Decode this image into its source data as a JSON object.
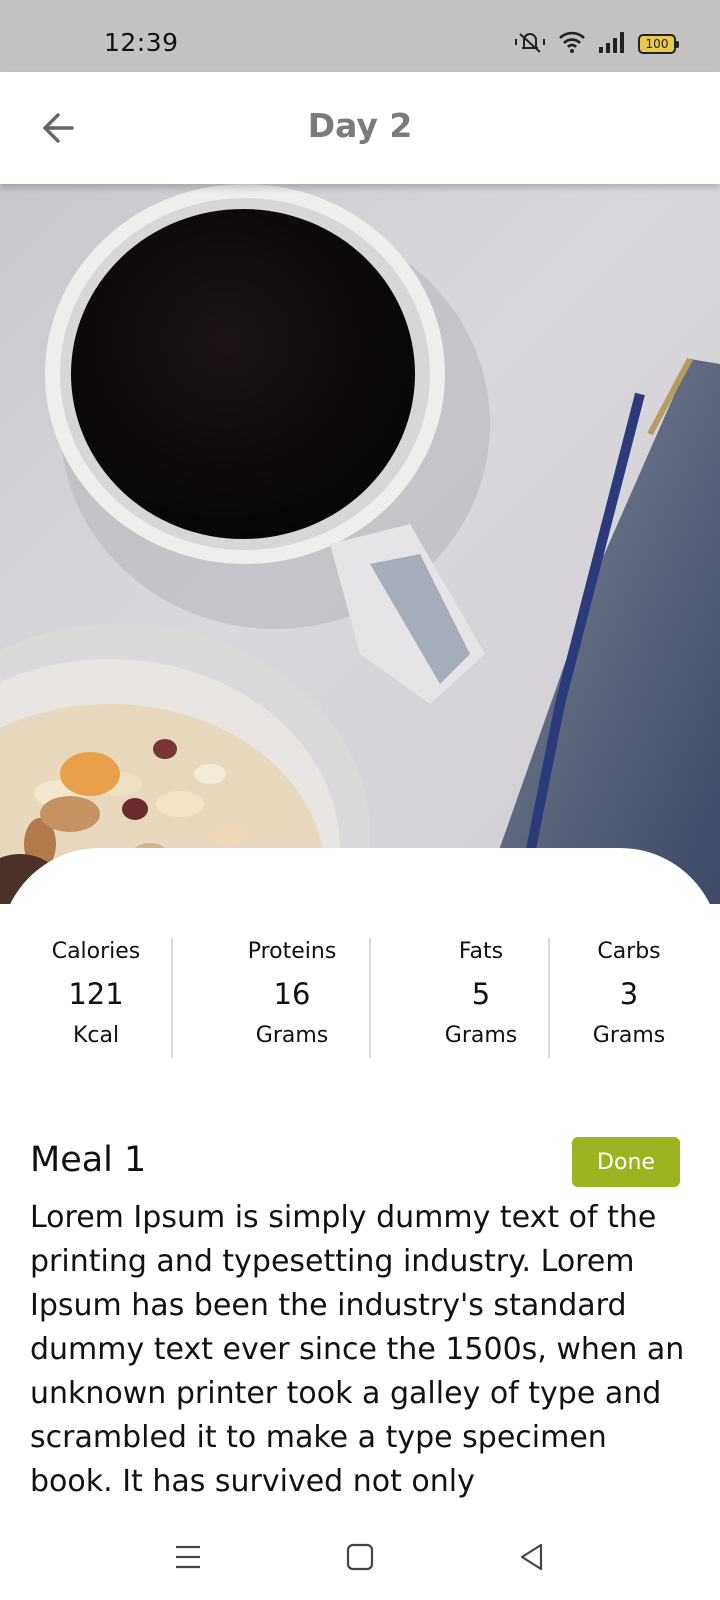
{
  "status_bar": {
    "time": "12:39",
    "battery": "100",
    "icons": [
      "vibrate-off-icon",
      "wifi-icon",
      "signal-icon",
      "battery-icon"
    ]
  },
  "app_bar": {
    "title": "Day 2",
    "back_icon": "arrow-left-icon"
  },
  "hero_image": {
    "subject": "coffee-mug-granola-bowl-book",
    "accent_colors": [
      "#0e0b0d",
      "#3b4a63",
      "#e7d7b9"
    ]
  },
  "stats": [
    {
      "label": "Calories",
      "value": "121",
      "unit": "Kcal"
    },
    {
      "label": "Proteins",
      "value": "16",
      "unit": "Grams"
    },
    {
      "label": "Fats",
      "value": "5",
      "unit": "Grams"
    },
    {
      "label": "Carbs",
      "value": "3",
      "unit": "Grams"
    }
  ],
  "meal": {
    "title": "Meal 1",
    "done_label": "Done",
    "description": "Lorem Ipsum is simply dummy text of the printing and typesetting industry. Lorem Ipsum has been the industry's standard dummy text ever since the 1500s, when an unknown printer took a galley of type and scrambled it to make a type specimen book. It has survived not only"
  },
  "colors": {
    "status_bar_bg": "#c2c2c2",
    "title_text": "#7b7b7b",
    "done_button_bg": "#9ab51f"
  },
  "nav_bar": {
    "icons": [
      "menu-icon",
      "home-square-icon",
      "back-triangle-icon"
    ]
  }
}
